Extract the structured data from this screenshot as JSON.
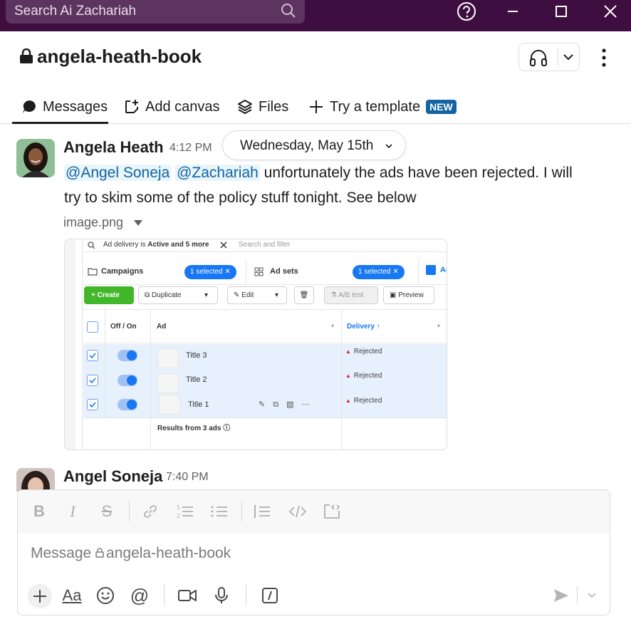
{
  "titlebar": {
    "search_placeholder": "Search Ai Zachariah",
    "icons": [
      "help-icon",
      "minimize-icon",
      "maximize-icon",
      "close-icon"
    ]
  },
  "channel": {
    "name": "angela-heath-book",
    "private": true
  },
  "tabs": [
    {
      "label": "Messages",
      "icon": "message-bubble-icon",
      "active": true
    },
    {
      "label": "Add canvas",
      "icon": "canvas-icon",
      "active": false
    },
    {
      "label": "Files",
      "icon": "layers-icon",
      "active": false
    },
    {
      "label": "Try a template",
      "icon": "plus-icon",
      "badge": "NEW",
      "active": false
    }
  ],
  "date_divider": "Wednesday, May 15th",
  "messages": [
    {
      "author": "Angela Heath",
      "time": "4:12 PM",
      "mention1": "@Angel Soneja",
      "mention2": "@Zachariah",
      "text_line1_rest": " unfortunately the ads have been rejected.  I will",
      "text_line2": "try to skim some of the policy stuff tonight.  See below",
      "attachment_name": "image.png"
    },
    {
      "author": "Angel Soneja",
      "time": "7:40 PM"
    }
  ],
  "attachment_image": {
    "filter_text_prefix": "Ad delivery is ",
    "filter_text_bold": "Active and 5 more",
    "filter_placeholder": "Search and filter",
    "tab_campaigns": "Campaigns",
    "tab_campaigns_chip": "1 selected",
    "tab_adsets": "Ad sets",
    "tab_adsets_chip": "1 selected",
    "tab_ads_partial": "Ac",
    "toolbar": {
      "create": "Create",
      "duplicate": "Duplicate",
      "edit": "Edit",
      "ab_test": "A/B test",
      "preview": "Preview"
    },
    "columns": {
      "offon": "Off / On",
      "ad": "Ad",
      "delivery": "Delivery ↑"
    },
    "rows": [
      {
        "title": "Title 3",
        "delivery": "Rejected"
      },
      {
        "title": "Title 2",
        "delivery": "Rejected"
      },
      {
        "title": "Title 1",
        "delivery": "Rejected"
      }
    ],
    "results": "Results from 3 ads"
  },
  "composer": {
    "placeholder_prefix": "Message ",
    "placeholder_channel": "angela-heath-book",
    "format_icons": [
      "bold-icon",
      "italic-icon",
      "strikethrough-icon",
      "link-icon",
      "ordered-list-icon",
      "bulleted-list-icon",
      "blockquote-icon",
      "code-icon",
      "code-block-icon"
    ],
    "action_icons": [
      "plus-icon",
      "text-format-icon",
      "emoji-icon",
      "mention-icon",
      "video-icon",
      "microphone-icon",
      "slash-command-icon",
      "send-icon",
      "chevron-down-icon"
    ]
  }
}
